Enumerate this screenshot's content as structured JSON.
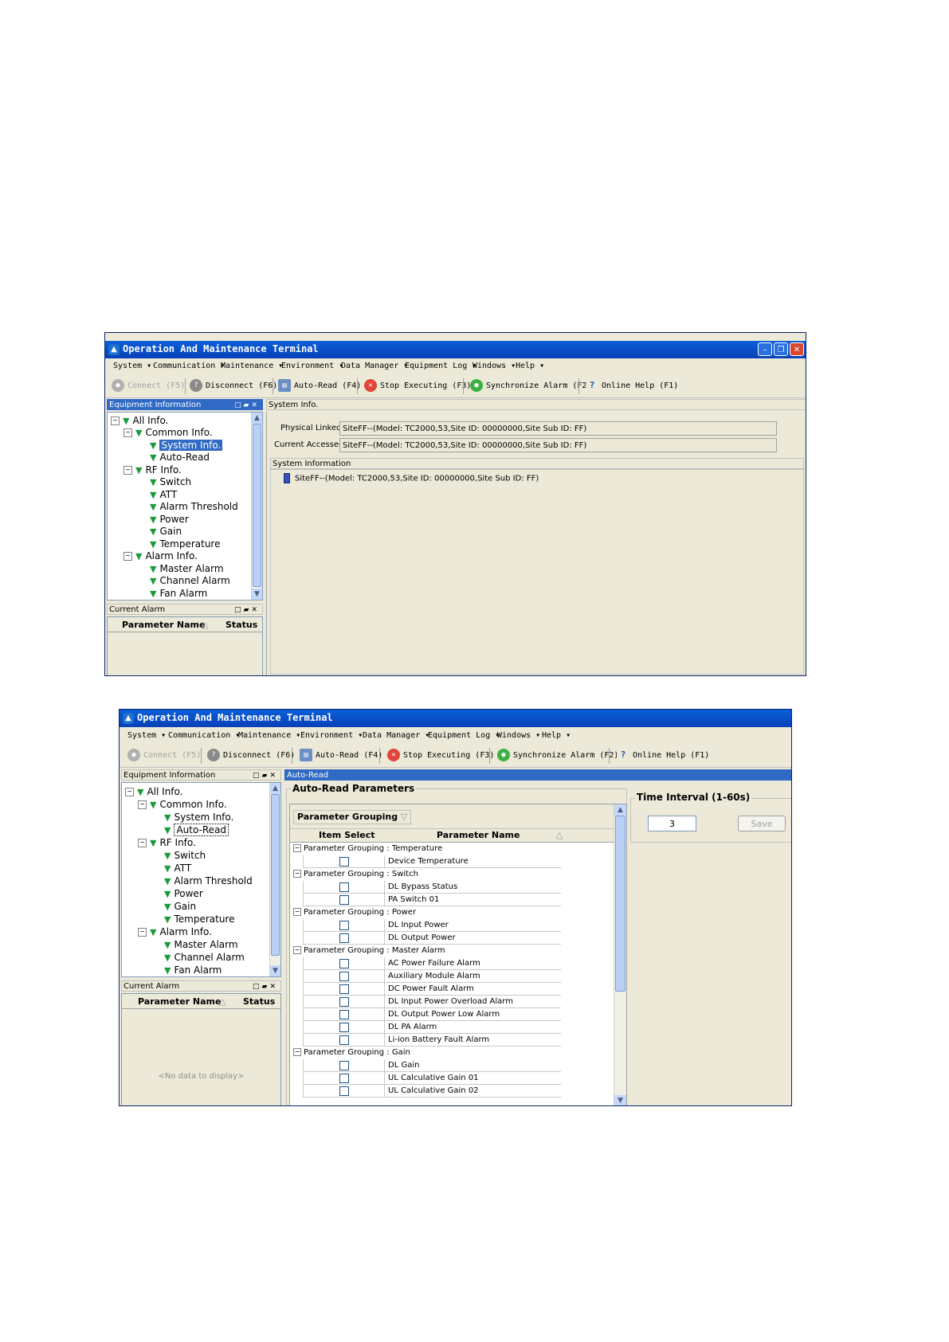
{
  "window_title": "Operation And Maintenance Terminal",
  "menu": [
    "System",
    "Communication",
    "Maintenance",
    "Environment",
    "Data Manager",
    "Equipment Log",
    "Windows",
    "Help"
  ],
  "toolbar": {
    "connect": "Connect (F5)",
    "disconnect": "Disconnect (F6)",
    "auto_read": "Auto-Read (F4)",
    "stop": "Stop Executing (F3)",
    "sync": "Synchronize Alarm (F2)",
    "help": "Online Help (F1)"
  },
  "equipment_panel_title": "Equipment Information",
  "tree": {
    "all": "All Info.",
    "common": "Common Info.",
    "system_info": "System Info.",
    "auto_read": "Auto-Read",
    "rf": "RF Info.",
    "switch": "Switch",
    "att": "ATT",
    "alarm_threshold": "Alarm Threshold",
    "power": "Power",
    "gain": "Gain",
    "temperature": "Temperature",
    "alarm": "Alarm Info.",
    "master_alarm": "Master Alarm",
    "channel_alarm": "Channel Alarm",
    "fan_alarm": "Fan Alarm"
  },
  "current_alarm": {
    "title": "Current Alarm",
    "col_name": "Parameter Name",
    "col_status": "Status",
    "empty": "<No data to display>"
  },
  "screen1": {
    "tab": "System Info.",
    "physical_linked_label": "Physical Linked",
    "physical_linked_value": "SiteFF--(Model: TC2000,53,Site ID: 00000000,Site Sub ID: FF)",
    "current_accessed_label": "Current Accessed",
    "current_accessed_value": "SiteFF--(Model: TC2000,53,Site ID: 00000000,Site Sub ID: FF)",
    "sysinfo_header": "System Information",
    "sysinfo_item": "SiteFF--(Model: TC2000,53,Site ID: 00000000,Site Sub ID: FF)"
  },
  "screen2": {
    "tab": "Auto-Read",
    "params_title": "Auto-Read Parameters",
    "grouping_button": "Parameter Grouping",
    "col_item_select": "Item Select",
    "col_param_name": "Parameter Name",
    "groups": [
      {
        "label": "Parameter Grouping : Temperature",
        "items": [
          "Device Temperature"
        ]
      },
      {
        "label": "Parameter Grouping : Switch",
        "items": [
          "DL Bypass Status",
          "PA Switch 01"
        ]
      },
      {
        "label": "Parameter Grouping : Power",
        "items": [
          "DL Input Power",
          "DL Output Power"
        ]
      },
      {
        "label": "Parameter Grouping : Master Alarm",
        "items": [
          "AC Power Failure Alarm",
          "Auxiliary Module Alarm",
          "DC Power Fault Alarm",
          "DL Input Power Overload Alarm",
          "DL Output Power Low Alarm",
          "DL PA Alarm",
          "Li-ion Battery Fault Alarm"
        ]
      },
      {
        "label": "Parameter Grouping : Gain",
        "items": [
          "DL Gain",
          "UL Calculative Gain 01",
          "UL Calculative Gain 02"
        ]
      }
    ],
    "time_interval_title": "Time Interval (1-60s)",
    "time_interval_value": "3",
    "save_button": "Save"
  },
  "colors": {
    "title_bar": "#0a5fd8",
    "selection": "#316ac5",
    "tree_marker": "#1a9a3a",
    "face": "#ece9d8"
  }
}
